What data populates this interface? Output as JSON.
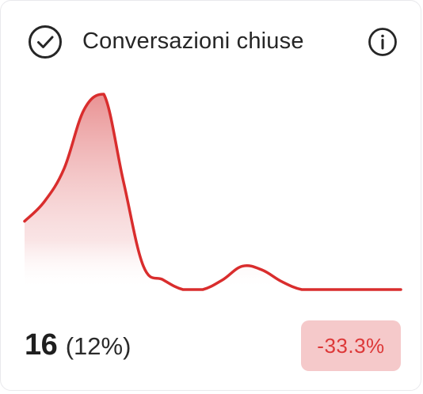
{
  "card": {
    "title": "Conversazioni chiuse",
    "value": "16",
    "percent": "(12%)",
    "delta": "-33.3%"
  },
  "icons": {
    "status": "check-circle-icon",
    "info": "info-icon"
  },
  "colors": {
    "line": "#d92d2d",
    "fill_top": "#e57f80",
    "badge_bg": "#f5c9ca",
    "badge_text": "#dd3838",
    "text": "#262626"
  },
  "chart_data": {
    "type": "area",
    "x": [
      0,
      1,
      2,
      3,
      4,
      5,
      6,
      7,
      8,
      9,
      10,
      11,
      12,
      13,
      14,
      15,
      16,
      17,
      18,
      19
    ],
    "series": [
      {
        "values": [
          0.35,
          0.45,
          0.62,
          0.92,
          1.0,
          0.55,
          0.12,
          0.05,
          0.0,
          0.0,
          0.05,
          0.12,
          0.1,
          0.04,
          0.0,
          0.0,
          0.0,
          0.0,
          0.0,
          0.0
        ]
      }
    ],
    "ylim": [
      0,
      1
    ],
    "grid": false,
    "legend": "none"
  }
}
